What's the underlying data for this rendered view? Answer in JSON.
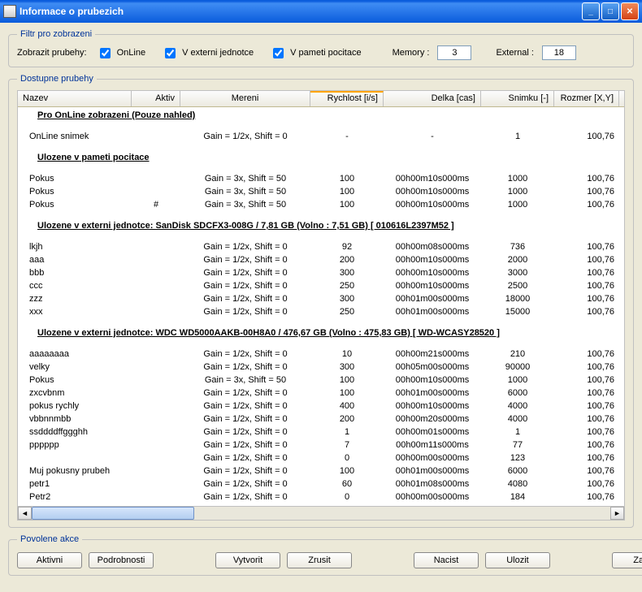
{
  "window": {
    "title": "Informace o prubezich"
  },
  "filter": {
    "legend": "Filtr pro zobrazeni",
    "zobrazit_label": "Zobrazit prubehy:",
    "online_label": "OnLine",
    "vexterni_label": "V externi jednotce",
    "vpameti_label": "V pameti pocitace",
    "memory_label": "Memory :",
    "memory_value": "3",
    "external_label": "External :",
    "external_value": "18"
  },
  "grid": {
    "legend": "Dostupne prubehy",
    "headers": {
      "nazev": "Nazev",
      "aktiv": "Aktiv",
      "mereni": "Mereni",
      "rychlost": "Rychlost [i/s]",
      "delka": "Delka [cas]",
      "snimku": "Snimku [-]",
      "rozmer": "Rozmer [X,Y]"
    },
    "section_online": "Pro OnLine zobrazeni (Pouze nahled)",
    "online_rows": [
      {
        "nazev": "OnLine snimek",
        "aktiv": "",
        "mereni": "Gain = 1/2x, Shift = 0",
        "rychlost": "-",
        "delka": "-",
        "snimku": "1",
        "rozmer": "100,76"
      }
    ],
    "section_pamet": "Ulozene v pameti pocitace",
    "pamet_rows": [
      {
        "nazev": "Pokus",
        "aktiv": "",
        "mereni": "Gain = 3x, Shift = 50",
        "rychlost": "100",
        "delka": "00h00m10s000ms",
        "snimku": "1000",
        "rozmer": "100,76"
      },
      {
        "nazev": "Pokus",
        "aktiv": "",
        "mereni": "Gain = 3x, Shift = 50",
        "rychlost": "100",
        "delka": "00h00m10s000ms",
        "snimku": "1000",
        "rozmer": "100,76"
      },
      {
        "nazev": "Pokus",
        "aktiv": "#",
        "mereni": "Gain = 3x, Shift = 50",
        "rychlost": "100",
        "delka": "00h00m10s000ms",
        "snimku": "1000",
        "rozmer": "100,76"
      }
    ],
    "section_ext1": "Ulozene v externi jednotce: SanDisk SDCFX3-008G / 7,81 GB (Volno : 7,51 GB) [ 010616L2397M52 ]",
    "ext1_rows": [
      {
        "nazev": "lkjh",
        "aktiv": "",
        "mereni": "Gain = 1/2x, Shift = 0",
        "rychlost": "92",
        "delka": "00h00m08s000ms",
        "snimku": "736",
        "rozmer": "100,76"
      },
      {
        "nazev": "aaa",
        "aktiv": "",
        "mereni": "Gain = 1/2x, Shift = 0",
        "rychlost": "200",
        "delka": "00h00m10s000ms",
        "snimku": "2000",
        "rozmer": "100,76"
      },
      {
        "nazev": "bbb",
        "aktiv": "",
        "mereni": "Gain = 1/2x, Shift = 0",
        "rychlost": "300",
        "delka": "00h00m10s000ms",
        "snimku": "3000",
        "rozmer": "100,76"
      },
      {
        "nazev": "ccc",
        "aktiv": "",
        "mereni": "Gain = 1/2x, Shift = 0",
        "rychlost": "250",
        "delka": "00h00m10s000ms",
        "snimku": "2500",
        "rozmer": "100,76"
      },
      {
        "nazev": "zzz",
        "aktiv": "",
        "mereni": "Gain = 1/2x, Shift = 0",
        "rychlost": "300",
        "delka": "00h01m00s000ms",
        "snimku": "18000",
        "rozmer": "100,76"
      },
      {
        "nazev": "xxx",
        "aktiv": "",
        "mereni": "Gain = 1/2x, Shift = 0",
        "rychlost": "250",
        "delka": "00h01m00s000ms",
        "snimku": "15000",
        "rozmer": "100,76"
      }
    ],
    "section_ext2": "Ulozene v externi jednotce: WDC WD5000AAKB-00H8A0 / 476,67 GB (Volno : 475,83 GB) [ WD-WCASY28520 ]",
    "ext2_rows": [
      {
        "nazev": "aaaaaaaa",
        "aktiv": "",
        "mereni": "Gain = 1/2x, Shift = 0",
        "rychlost": "10",
        "delka": "00h00m21s000ms",
        "snimku": "210",
        "rozmer": "100,76"
      },
      {
        "nazev": "velky",
        "aktiv": "",
        "mereni": "Gain = 1/2x, Shift = 0",
        "rychlost": "300",
        "delka": "00h05m00s000ms",
        "snimku": "90000",
        "rozmer": "100,76"
      },
      {
        "nazev": "Pokus",
        "aktiv": "",
        "mereni": "Gain = 3x, Shift = 50",
        "rychlost": "100",
        "delka": "00h00m10s000ms",
        "snimku": "1000",
        "rozmer": "100,76"
      },
      {
        "nazev": "zxcvbnm",
        "aktiv": "",
        "mereni": "Gain = 1/2x, Shift = 0",
        "rychlost": "100",
        "delka": "00h01m00s000ms",
        "snimku": "6000",
        "rozmer": "100,76"
      },
      {
        "nazev": "pokus rychly",
        "aktiv": "",
        "mereni": "Gain = 1/2x, Shift = 0",
        "rychlost": "400",
        "delka": "00h00m10s000ms",
        "snimku": "4000",
        "rozmer": "100,76"
      },
      {
        "nazev": "vbbnnmbb",
        "aktiv": "",
        "mereni": "Gain = 1/2x, Shift = 0",
        "rychlost": "200",
        "delka": "00h00m20s000ms",
        "snimku": "4000",
        "rozmer": "100,76"
      },
      {
        "nazev": "ssddddffggghh",
        "aktiv": "",
        "mereni": "Gain = 1/2x, Shift = 0",
        "rychlost": "1",
        "delka": "00h00m01s000ms",
        "snimku": "1",
        "rozmer": "100,76"
      },
      {
        "nazev": "pppppp",
        "aktiv": "",
        "mereni": "Gain = 1/2x, Shift = 0",
        "rychlost": "7",
        "delka": "00h00m11s000ms",
        "snimku": "77",
        "rozmer": "100,76"
      },
      {
        "nazev": "",
        "aktiv": "",
        "mereni": "Gain = 1/2x, Shift = 0",
        "rychlost": "0",
        "delka": "00h00m00s000ms",
        "snimku": "123",
        "rozmer": "100,76"
      },
      {
        "nazev": "Muj pokusny prubeh",
        "aktiv": "",
        "mereni": "Gain = 1/2x, Shift = 0",
        "rychlost": "100",
        "delka": "00h01m00s000ms",
        "snimku": "6000",
        "rozmer": "100,76"
      },
      {
        "nazev": "petr1",
        "aktiv": "",
        "mereni": "Gain = 1/2x, Shift = 0",
        "rychlost": "60",
        "delka": "00h01m08s000ms",
        "snimku": "4080",
        "rozmer": "100,76"
      },
      {
        "nazev": "Petr2",
        "aktiv": "",
        "mereni": "Gain = 1/2x, Shift = 0",
        "rychlost": "0",
        "delka": "00h00m00s000ms",
        "snimku": "184",
        "rozmer": "100,76"
      }
    ]
  },
  "actions": {
    "legend": "Povolene akce",
    "aktivni": "Aktivni",
    "podrobnosti": "Podrobnosti",
    "vytvorit": "Vytvorit",
    "zrusit": "Zrusit",
    "nacist": "Nacist",
    "ulozit": "Ulozit",
    "zavrit": "Zavrit"
  }
}
